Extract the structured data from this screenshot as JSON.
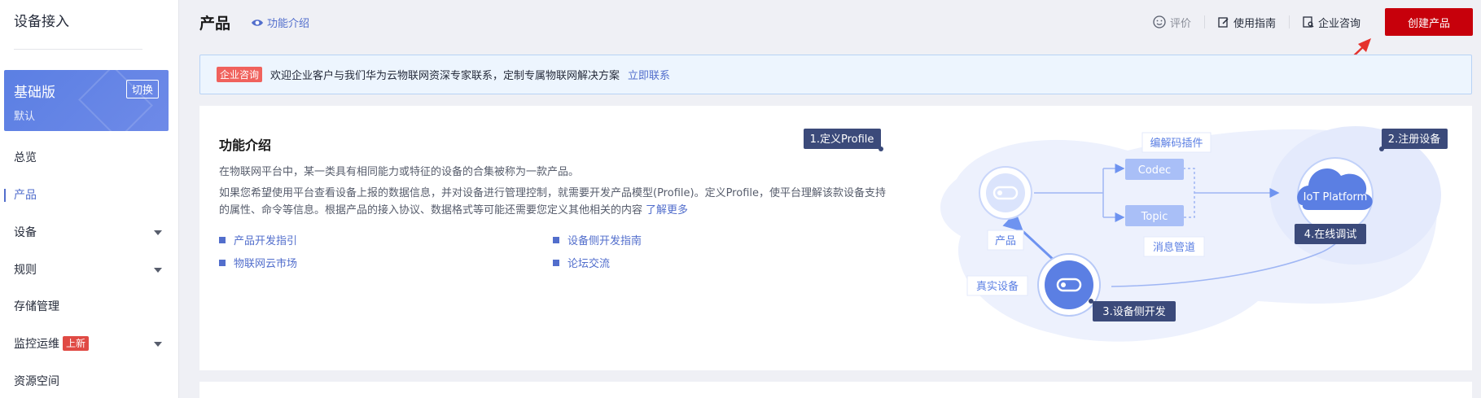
{
  "sidebar": {
    "title": "设备接入",
    "edition": {
      "name": "基础版",
      "sub": "默认",
      "switch_label": "切换"
    },
    "items": [
      {
        "label": "总览"
      },
      {
        "label": "产品"
      },
      {
        "label": "设备"
      },
      {
        "label": "规则"
      },
      {
        "label": "存储管理"
      },
      {
        "label": "监控运维",
        "badge": "上新"
      },
      {
        "label": "资源空间"
      }
    ],
    "active_index": 1
  },
  "header": {
    "title": "产品",
    "func_link": "功能介绍",
    "actions": {
      "rate": "评价",
      "guide": "使用指南",
      "consult": "企业咨询",
      "create": "创建产品"
    }
  },
  "notice": {
    "tag": "企业咨询",
    "text": "欢迎企业客户与我们华为云物联网资深专家联系，定制专属物联网解决方案",
    "link": "立即联系"
  },
  "intro": {
    "title": "功能介绍",
    "desc1": "在物联网平台中，某一类具有相同能力或特征的设备的合集被称为一款产品。",
    "desc2": "如果您希望使用平台查看设备上报的数据信息，并对设备进行管理控制，就需要开发产品模型(Profile)。定义Profile，使平台理解该款设备支持的属性、命令等信息。根据产品的接入协议、数据格式等可能还需要您定义其他相关的内容",
    "learn_more": "了解更多",
    "links": [
      "产品开发指引",
      "设备侧开发指南",
      "物联网云市场",
      "论坛交流"
    ]
  },
  "diagram": {
    "step1": "1.定义Profile",
    "step2": "2.注册设备",
    "step3": "3.设备侧开发",
    "step4": "4.在线调试",
    "codec_plugin": "编解码插件",
    "codec": "Codec",
    "topic": "Topic",
    "msg_pipe": "消息管道",
    "product": "产品",
    "real_device": "真实设备",
    "platform": "IoT Platform"
  },
  "colors": {
    "accent": "#526ecc",
    "primary_button": "#c7000b",
    "badge_red": "#e04a44",
    "step_label_bg": "#3b4a7a"
  }
}
